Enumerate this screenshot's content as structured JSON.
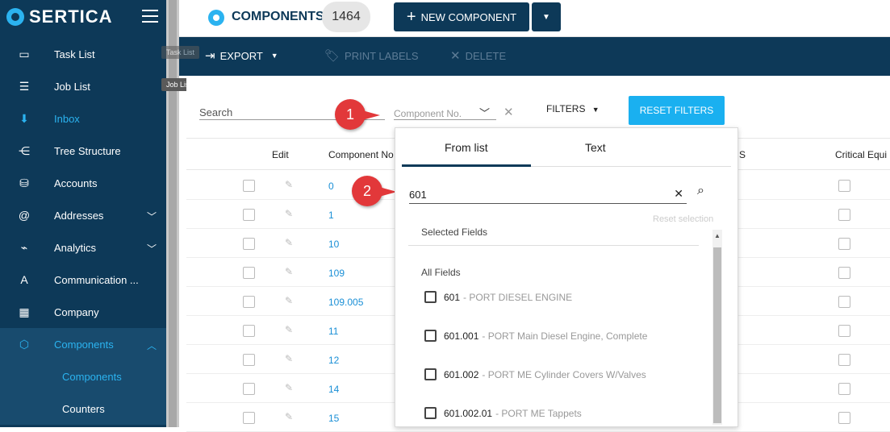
{
  "brand": {
    "name": "SERTICA"
  },
  "sidebar": {
    "items": [
      {
        "label": "Task List",
        "icon": "task-list-icon"
      },
      {
        "label": "Job List",
        "icon": "job-list-icon"
      },
      {
        "label": "Inbox",
        "icon": "inbox-icon"
      },
      {
        "label": "Tree Structure",
        "icon": "tree-structure-icon"
      },
      {
        "label": "Accounts",
        "icon": "accounts-icon"
      },
      {
        "label": "Addresses",
        "icon": "addresses-icon"
      },
      {
        "label": "Analytics",
        "icon": "analytics-icon"
      },
      {
        "label": "Communication ...",
        "icon": "communication-icon"
      },
      {
        "label": "Company",
        "icon": "company-icon"
      },
      {
        "label": "Components",
        "icon": "components-icon"
      }
    ],
    "sub_items": [
      {
        "label": "Components"
      },
      {
        "label": "Counters"
      }
    ]
  },
  "tooltips": {
    "task_list": "Task List",
    "job_list": "Job List"
  },
  "header": {
    "title": "COMPONENTS",
    "count": "1464",
    "new_button": "NEW COMPONENT"
  },
  "toolbar": {
    "export": "EXPORT",
    "print_labels": "PRINT LABELS",
    "delete": "DELETE"
  },
  "filters_bar": {
    "search_label": "Search",
    "component_no_placeholder": "Component No.",
    "filters_label": "FILTERS",
    "reset_button": "RESET FILTERS"
  },
  "table": {
    "headers": {
      "edit": "Edit",
      "component_no": "Component No",
      "critical": "Critical Equi",
      "partial_s": "S"
    },
    "rows": [
      {
        "component_no": "0"
      },
      {
        "component_no": "1"
      },
      {
        "component_no": "10"
      },
      {
        "component_no": "109"
      },
      {
        "component_no": "109.005"
      },
      {
        "component_no": "11"
      },
      {
        "component_no": "12"
      },
      {
        "component_no": "14"
      },
      {
        "component_no": "15"
      }
    ]
  },
  "dropdown": {
    "tabs": [
      "From list",
      "Text"
    ],
    "input_value": "601",
    "reset_selection": "Reset selection",
    "selected_fields_label": "Selected Fields",
    "all_fields_label": "All Fields",
    "options": [
      {
        "code": "601",
        "desc": "- PORT DIESEL ENGINE"
      },
      {
        "code": "601.001",
        "desc": "- PORT Main Diesel Engine, Complete"
      },
      {
        "code": "601.002",
        "desc": "- PORT ME Cylinder Covers W/Valves"
      },
      {
        "code": "601.002.01",
        "desc": "- PORT ME Tappets"
      }
    ]
  },
  "markers": [
    "1",
    "2"
  ],
  "colors": {
    "navy": "#0d3958",
    "accent": "#1ab0f0",
    "marker": "#e2383a"
  }
}
